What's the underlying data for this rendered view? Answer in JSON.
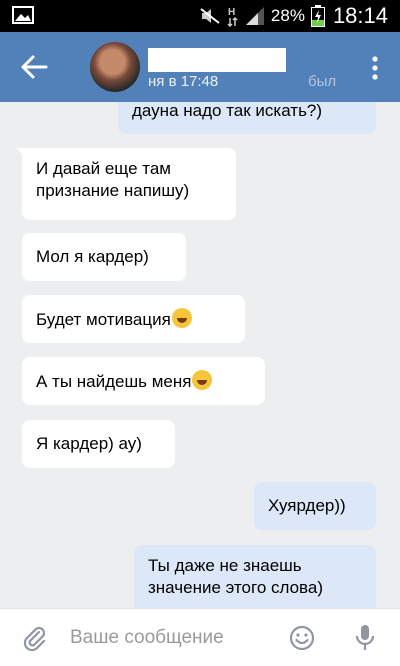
{
  "status_bar": {
    "battery_percent": "28%",
    "time": "18:14"
  },
  "header": {
    "status_visible": "ня в 17:48",
    "status_tail": "был"
  },
  "messages": [
    {
      "direction": "out",
      "text": "дауна надо так искать?)"
    },
    {
      "direction": "in",
      "lines": [
        "И давай еще там",
        "признание напишу)"
      ]
    },
    {
      "direction": "in",
      "text": "Мол я кардер)"
    },
    {
      "direction": "in",
      "text": "Будет мотивация",
      "emoji": "rolling-on-floor-laughing"
    },
    {
      "direction": "in",
      "text": "А ты найдешь меня",
      "emoji": "rolling-on-floor-laughing"
    },
    {
      "direction": "in",
      "text": "Я кардер) ау)"
    },
    {
      "direction": "out",
      "text": "Хуярдер))"
    },
    {
      "direction": "out",
      "lines": [
        "Ты даже не знаешь",
        "значение этого слова)"
      ]
    }
  ],
  "composer": {
    "placeholder": "Ваше сообщение"
  },
  "colors": {
    "header": "#5181b8",
    "background": "#edeef0",
    "incoming": "#ffffff",
    "outgoing": "#dce8f7"
  }
}
